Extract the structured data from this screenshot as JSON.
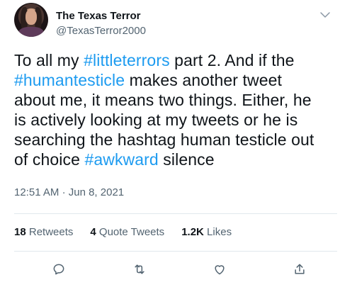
{
  "author": {
    "display_name": "The Texas Terror",
    "handle": "@TexasTerror2000"
  },
  "tweet": {
    "lines": [
      [
        {
          "t": "To all my ",
          "tag": false
        },
        {
          "t": "#littleterrors",
          "tag": true
        },
        {
          "t": " part 2. And if the",
          "tag": false
        }
      ],
      [
        {
          "t": "#humantesticle",
          "tag": true
        },
        {
          "t": " makes another tweet",
          "tag": false
        }
      ],
      [
        {
          "t": "about me, it means two things. Either, he",
          "tag": false
        }
      ],
      [
        {
          "t": "is actively looking at my tweets or he is",
          "tag": false
        }
      ],
      [
        {
          "t": "searching the hashtag human testicle out",
          "tag": false
        }
      ],
      [
        {
          "t": "of choice ",
          "tag": false
        },
        {
          "t": "#awkward",
          "tag": true
        },
        {
          "t": " silence",
          "tag": false
        }
      ]
    ]
  },
  "meta": {
    "time": "12:51 AM",
    "separator": "·",
    "date": "Jun 8, 2021"
  },
  "stats": {
    "retweets": {
      "count": "18",
      "label": "Retweets"
    },
    "quotes": {
      "count": "4",
      "label": "Quote Tweets"
    },
    "likes": {
      "count": "1.2K",
      "label": "Likes"
    }
  },
  "icons": {
    "more": "chevron-down-icon",
    "reply": "reply-icon",
    "retweet": "retweet-icon",
    "like": "heart-icon",
    "share": "share-icon"
  },
  "colors": {
    "hashtag": "#1d9bf0",
    "secondary_text": "#536471",
    "divider": "#e1e8ed"
  }
}
